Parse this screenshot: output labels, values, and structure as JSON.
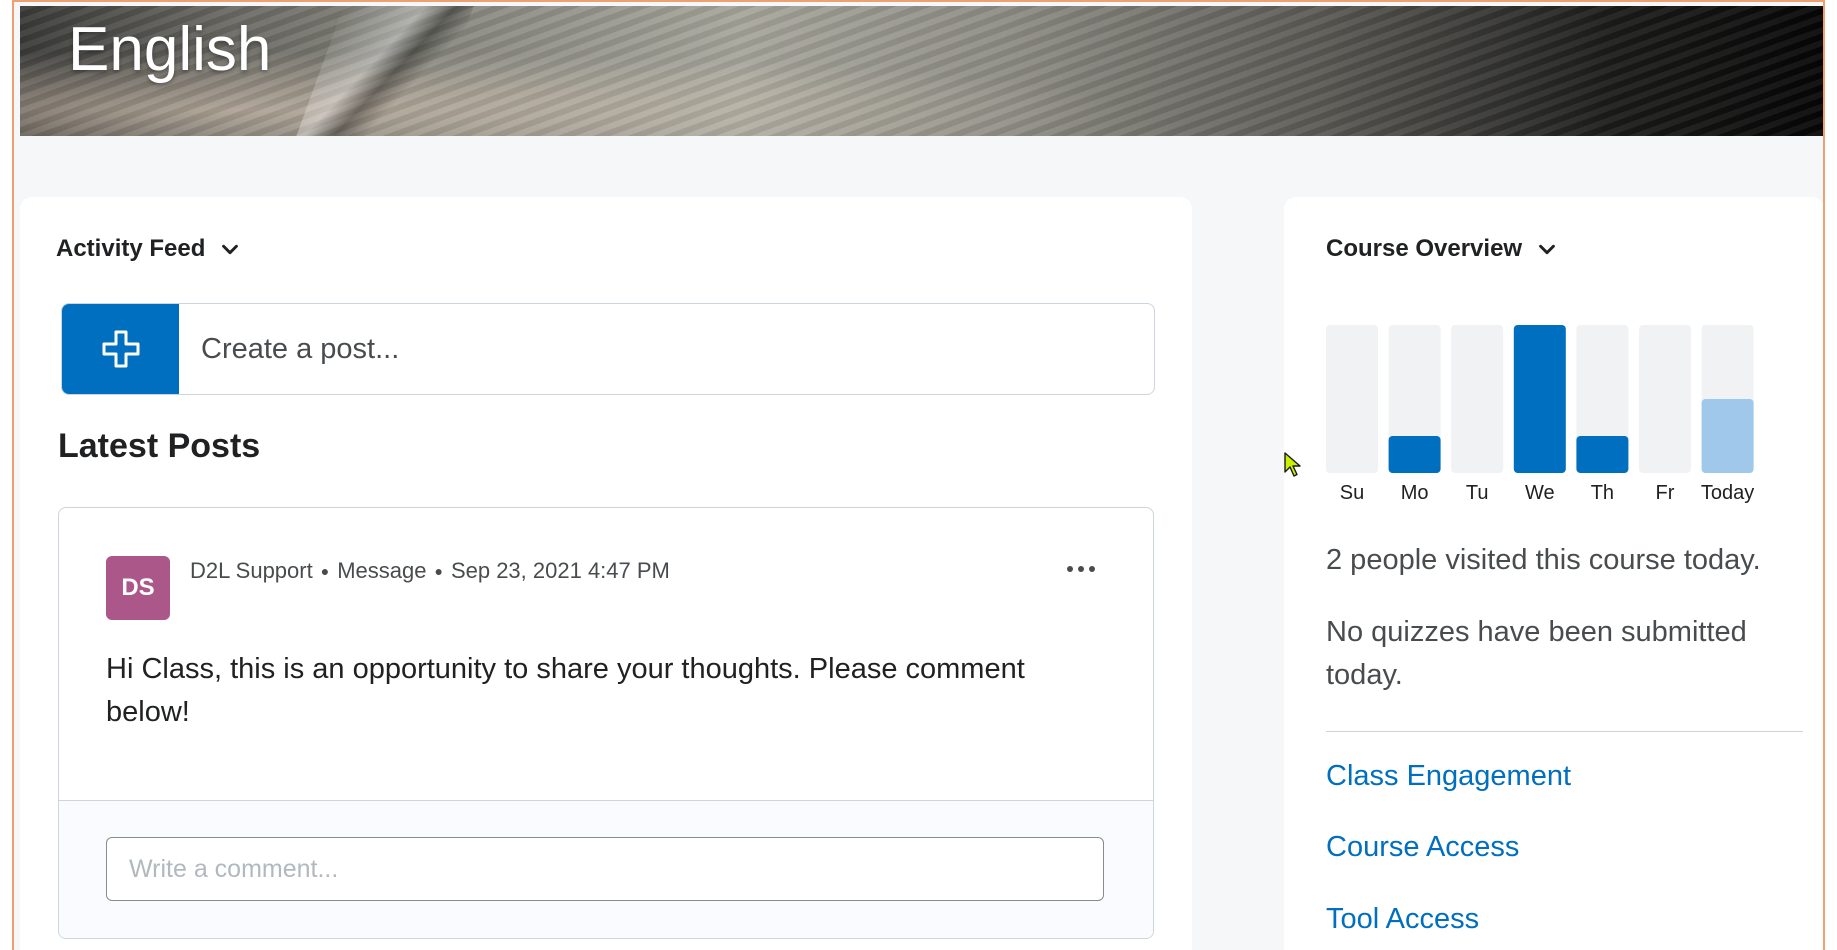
{
  "banner": {
    "title": "English"
  },
  "activity_feed": {
    "header": "Activity Feed",
    "create_post_placeholder": "Create a post...",
    "latest_posts_title": "Latest Posts",
    "post": {
      "avatar_initials": "DS",
      "avatar_color": "#ab578a",
      "author": "D2L Support",
      "type": "Message",
      "timestamp": "Sep 23, 2021 4:47 PM",
      "body": "Hi Class, this is an opportunity to share your thoughts. Please comment below!",
      "comment_placeholder": "Write a comment..."
    }
  },
  "course_overview": {
    "header": "Course Overview",
    "visits_text": "2 people visited this course today.",
    "quizzes_text": "No quizzes have been submitted today.",
    "links": [
      "Class Engagement",
      "Course Access",
      "Tool Access"
    ]
  },
  "colors": {
    "accent": "#006fbf",
    "today_bar": "#9fc8ea",
    "bar_track": "#f1f2f3"
  },
  "chart_data": {
    "type": "bar",
    "categories": [
      "Su",
      "Mo",
      "Tu",
      "We",
      "Th",
      "Fr",
      "Today"
    ],
    "values": [
      0,
      1,
      0,
      4,
      1,
      0,
      2
    ],
    "ylim": [
      0,
      4
    ],
    "grid": false
  }
}
